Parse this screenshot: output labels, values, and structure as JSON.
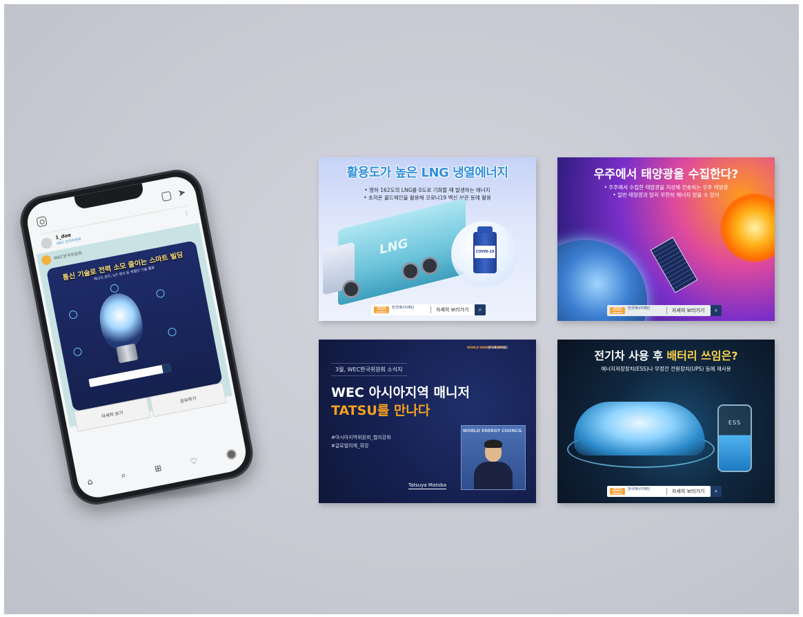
{
  "phone": {
    "username": "1_doe",
    "user_sub": "WEC 한국위원회",
    "post_head": "WEC한국위원회",
    "post_title": "통신 기술로 전력 소모 줄이는 스마트 빌딩",
    "post_sub": "에너지 관리, IoT 센서 등 최첨단 기술 활용",
    "view_more": "자세히 보기",
    "share": "공유하기"
  },
  "cards": {
    "lng": {
      "title": "활용도가 높은 LNG 냉열에너지",
      "bullets": [
        "• 영하 162도의 LNG를 0도로 기화할 때 발생하는 에너지",
        "• 초저온 콜드체인을 활용해 코로나19 백신 보관 등에 활용"
      ],
      "truck_label": "LNG",
      "vial_label": "COVID-19",
      "more": "자세히 보러가기"
    },
    "solar": {
      "title": "우주에서 태양광을 수집한다?",
      "bullets": [
        "• 우주에서 수집한 태양광을 지상에 전송하는 우주 태양광",
        "• 일반 태양광과 달리 무한히 에너지 얻을 수 있어"
      ],
      "more": "자세히 보러가기"
    },
    "wec": {
      "tag": "3월, WEC한국위원회 소식지",
      "headline1": "WEC 아시아지역 매니저",
      "headline2": "TATSU를 만나다",
      "hashtags": [
        "#아시아지역위원회_협지강화",
        "#글로벌의제_확장"
      ],
      "caption": "Tatsuya Matoba",
      "logo1": "WORLD ENERGY COUNCIL",
      "logo2": "한국에너지재단",
      "photo_mark": "WORLD ENERGY COUNCIL"
    },
    "ev": {
      "title_a": "전기차 사용 후 ",
      "title_b": "배터리 쓰임은?",
      "bullet": "에너지저장장치(ESS)나 무정전 전원장치(UPS) 등에 재사용",
      "battery_label": "ESS",
      "more": "자세히 보러가기"
    },
    "logo_left": "WORLD ENERGY COUNCIL",
    "logo_right": "한국에너지재단"
  }
}
